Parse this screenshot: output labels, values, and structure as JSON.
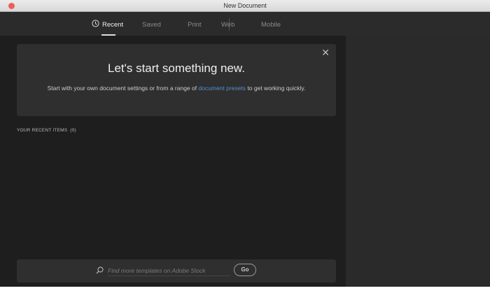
{
  "window": {
    "title": "New Document"
  },
  "tabs": [
    {
      "label": "Recent"
    },
    {
      "label": "Saved"
    },
    {
      "label": "Print"
    },
    {
      "label": "Web"
    },
    {
      "label": "Mobile"
    }
  ],
  "banner": {
    "headline": "Let's start something new.",
    "text_before": "Start with your own document settings or from a range of ",
    "link": "document presets",
    "text_after": " to get working quickly.",
    "close": "✕"
  },
  "recent": {
    "label": "YOUR RECENT ITEMS",
    "count": "(0)"
  },
  "search": {
    "placeholder": "Find more templates on Adobe Stock",
    "go_label": "Go"
  },
  "colors": {
    "accent": "#4f8fcf"
  }
}
